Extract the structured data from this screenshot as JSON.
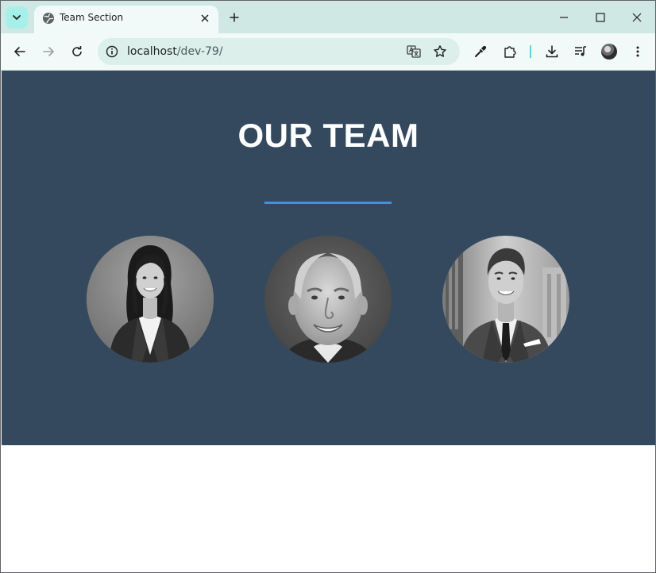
{
  "browser": {
    "tab": {
      "title": "Team Section"
    },
    "address_bar": {
      "host": "localhost",
      "path": "/dev-79/"
    }
  },
  "page": {
    "section_title": "OUR TEAM",
    "accent_color": "#3498db",
    "background_color": "#34495e",
    "members": [
      {
        "photo": "woman-in-blazer-portrait"
      },
      {
        "photo": "older-man-portrait"
      },
      {
        "photo": "young-man-in-suit-portrait"
      }
    ]
  }
}
